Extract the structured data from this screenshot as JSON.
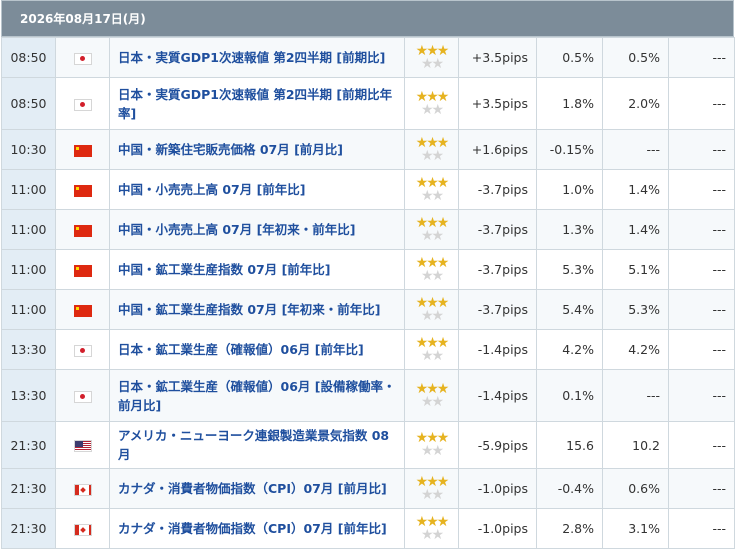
{
  "date_header": "2026年08月17日(月)",
  "colors": {
    "header_bg": "#7c8c99",
    "time_bg": "#e3edf5",
    "name_text": "#1f4f9e",
    "star_on": "#e6b320",
    "star_off": "#d4d4d4"
  },
  "events": [
    {
      "time": "08:50",
      "country": "jp",
      "flag_icon": "japan-flag-icon",
      "name": "日本・実質GDP1次速報値 第2四半期 [前期比]",
      "stars_top": "★★★",
      "stars_bottom": "★★",
      "impact": "+3.5pips",
      "previous": "0.5%",
      "forecast": "0.5%",
      "actual": "---"
    },
    {
      "time": "08:50",
      "country": "jp",
      "flag_icon": "japan-flag-icon",
      "name": "日本・実質GDP1次速報値 第2四半期 [前期比年率]",
      "stars_top": "★★★",
      "stars_bottom": "★★",
      "impact": "+3.5pips",
      "previous": "1.8%",
      "forecast": "2.0%",
      "actual": "---"
    },
    {
      "time": "10:30",
      "country": "cn",
      "flag_icon": "china-flag-icon",
      "name": "中国・新築住宅販売価格 07月 [前月比]",
      "stars_top": "★★★",
      "stars_bottom": "★★",
      "impact": "+1.6pips",
      "previous": "-0.15%",
      "forecast": "---",
      "actual": "---"
    },
    {
      "time": "11:00",
      "country": "cn",
      "flag_icon": "china-flag-icon",
      "name": "中国・小売売上高 07月 [前年比]",
      "stars_top": "★★★",
      "stars_bottom": "★★",
      "impact": "-3.7pips",
      "previous": "1.0%",
      "forecast": "1.4%",
      "actual": "---"
    },
    {
      "time": "11:00",
      "country": "cn",
      "flag_icon": "china-flag-icon",
      "name": "中国・小売売上高 07月 [年初来・前年比]",
      "stars_top": "★★★",
      "stars_bottom": "★★",
      "impact": "-3.7pips",
      "previous": "1.3%",
      "forecast": "1.4%",
      "actual": "---"
    },
    {
      "time": "11:00",
      "country": "cn",
      "flag_icon": "china-flag-icon",
      "name": "中国・鉱工業生産指数 07月 [前年比]",
      "stars_top": "★★★",
      "stars_bottom": "★★",
      "impact": "-3.7pips",
      "previous": "5.3%",
      "forecast": "5.1%",
      "actual": "---"
    },
    {
      "time": "11:00",
      "country": "cn",
      "flag_icon": "china-flag-icon",
      "name": "中国・鉱工業生産指数 07月 [年初来・前年比]",
      "stars_top": "★★★",
      "stars_bottom": "★★",
      "impact": "-3.7pips",
      "previous": "5.4%",
      "forecast": "5.3%",
      "actual": "---"
    },
    {
      "time": "13:30",
      "country": "jp",
      "flag_icon": "japan-flag-icon",
      "name": "日本・鉱工業生産（確報値）06月 [前年比]",
      "stars_top": "★★★",
      "stars_bottom": "★★",
      "impact": "-1.4pips",
      "previous": "4.2%",
      "forecast": "4.2%",
      "actual": "---"
    },
    {
      "time": "13:30",
      "country": "jp",
      "flag_icon": "japan-flag-icon",
      "name": "日本・鉱工業生産（確報値）06月 [設備稼働率・前月比]",
      "stars_top": "★★★",
      "stars_bottom": "★★",
      "impact": "-1.4pips",
      "previous": "0.1%",
      "forecast": "---",
      "actual": "---"
    },
    {
      "time": "21:30",
      "country": "us",
      "flag_icon": "us-flag-icon",
      "name": "アメリカ・ニューヨーク連銀製造業景気指数 08月",
      "stars_top": "★★★",
      "stars_bottom": "★★",
      "impact": "-5.9pips",
      "previous": "15.6",
      "forecast": "10.2",
      "actual": "---"
    },
    {
      "time": "21:30",
      "country": "ca",
      "flag_icon": "canada-flag-icon",
      "name": "カナダ・消費者物価指数（CPI）07月 [前月比]",
      "stars_top": "★★★",
      "stars_bottom": "★★",
      "impact": "-1.0pips",
      "previous": "-0.4%",
      "forecast": "0.6%",
      "actual": "---"
    },
    {
      "time": "21:30",
      "country": "ca",
      "flag_icon": "canada-flag-icon",
      "name": "カナダ・消費者物価指数（CPI）07月 [前年比]",
      "stars_top": "★★★",
      "stars_bottom": "★★",
      "impact": "-1.0pips",
      "previous": "2.8%",
      "forecast": "3.1%",
      "actual": "---"
    }
  ]
}
